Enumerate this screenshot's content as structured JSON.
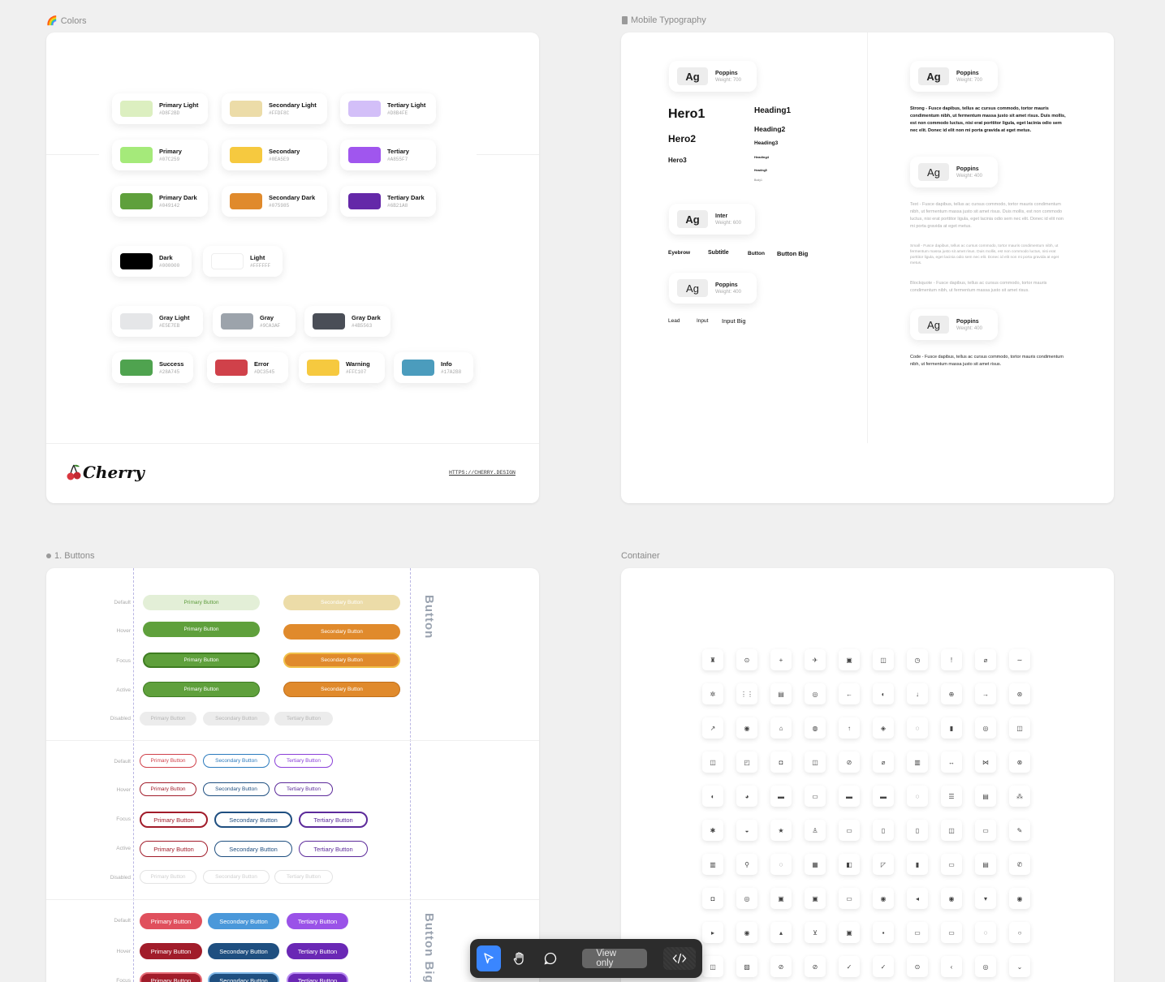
{
  "frames": {
    "colors": {
      "label": "Colors",
      "brand": "Cherry",
      "url": "HTTPS://CHERRY.DESIGN"
    },
    "typography": {
      "label": "Mobile Typography"
    },
    "buttons": {
      "label": "1. Buttons"
    },
    "container": {
      "label": "Container"
    }
  },
  "swatches": [
    {
      "name": "Primary Light",
      "hex": "#D8F2BD",
      "color": "#dcefc0"
    },
    {
      "name": "Secondary Light",
      "hex": "#FFDF8C",
      "color": "#ecdca8"
    },
    {
      "name": "Tertiary Light",
      "hex": "#D8B4FE",
      "color": "#d3bff8"
    },
    {
      "name": "Primary",
      "hex": "#07C259",
      "color": "#a5ea7a"
    },
    {
      "name": "Secondary",
      "hex": "#0EA5E9",
      "color": "#f6c93f"
    },
    {
      "name": "Tertiary",
      "hex": "#A855F7",
      "color": "#a056ee"
    },
    {
      "name": "Primary Dark",
      "hex": "#049142",
      "color": "#5fa03c"
    },
    {
      "name": "Secondary Dark",
      "hex": "#075985",
      "color": "#e08a2c"
    },
    {
      "name": "Tertiary Dark",
      "hex": "#6B21A8",
      "color": "#6428a8"
    },
    {
      "name": "Dark",
      "hex": "#000000",
      "color": "#000000"
    },
    {
      "name": "Light",
      "hex": "#FFFFFF",
      "color": "#ffffff"
    },
    {
      "name": "Gray Light",
      "hex": "#E5E7EB",
      "color": "#e5e6e8"
    },
    {
      "name": "Gray",
      "hex": "#9CA3AF",
      "color": "#9ca3ab"
    },
    {
      "name": "Gray Dark",
      "hex": "#4B5563",
      "color": "#4a4e57"
    },
    {
      "name": "Success",
      "hex": "#28A745",
      "color": "#4fa34f"
    },
    {
      "name": "Error",
      "hex": "#DC3545",
      "color": "#d0414a"
    },
    {
      "name": "Warning",
      "hex": "#FFC107",
      "color": "#f6c93f"
    },
    {
      "name": "Info",
      "hex": "#17A2B8",
      "color": "#4b9cbd"
    }
  ],
  "typography": {
    "cards": [
      {
        "ag": "Ag",
        "font": "Poppins",
        "weight": "Weight: 700"
      },
      {
        "ag": "Ag",
        "font": "Inter",
        "weight": "Weight: 600"
      },
      {
        "ag": "Ag",
        "font": "Poppins",
        "weight": "Weight: 400"
      },
      {
        "ag": "Ag",
        "font": "Poppins",
        "weight": "Weight: 700"
      },
      {
        "ag": "Ag",
        "font": "Poppins",
        "weight": "Weight: 400"
      },
      {
        "ag": "Ag",
        "font": "Poppins",
        "weight": "Weight: 400"
      }
    ],
    "heroes": [
      "Hero1",
      "Hero2",
      "Hero3"
    ],
    "headings": [
      "Heading1",
      "Heading2",
      "Heading3",
      "Heading4",
      "Heading5",
      "Body1"
    ],
    "small_labels": [
      "Eyebrow",
      "Subtitle",
      "Button",
      "Button Big"
    ],
    "lead_labels": [
      "Lead",
      "Input",
      "Input Big"
    ],
    "strong": "Strong - Fusce dapibus, tellus ac cursus commodo, tortor mauris condimentum nibh, ut fermentum massa justo sit amet risus. Duis mollis, est non commodo luctus, nisi erat porttitor ligula, eget lacinia odio sem nec elit. Donec id elit non mi porta gravida at eget metus.",
    "text": "Text - Fusce dapibus, tellus ac cursus commodo, tortor mauris condimentum nibh, ut fermentum massa justo sit amet risus. Duis mollis, est non commodo luctus, nisi erat porttitor ligula, eget lacinia odio sem nec elit. Donec id elit non mi porta gravida at eget metus.",
    "small": "Small - Fusce dapibus, tellus ac cursus commodo, tortor mauris condimentum nibh, ut fermentum massa justo sit amet risus. Duis mollis, est non commodo luctus, nisi erat porttitor ligula, eget lacinia odio sem nec elit. Donec id elit non mi porta gravida at eget metus.",
    "blockquote": "Blockquote - Fusce dapibus, tellus ac cursus commodo, tortor mauris condimentum nibh, ut fermentum massa justo sit amet risus.",
    "code": "Code - Fusce dapibus, tellus ac cursus commodo, tortor mauris condimentum nibh, ut fermentum massa justo sit amet risus."
  },
  "buttons": {
    "states": [
      "Default",
      "Hover",
      "Focus",
      "Active",
      "Disabled"
    ],
    "primary": "Primary Button",
    "secondary": "Secondary Button",
    "tertiary": "Tertiary Button",
    "section_button": "Button",
    "section_button_big": "Button Big"
  },
  "toolbar": {
    "view_only": "View only"
  }
}
